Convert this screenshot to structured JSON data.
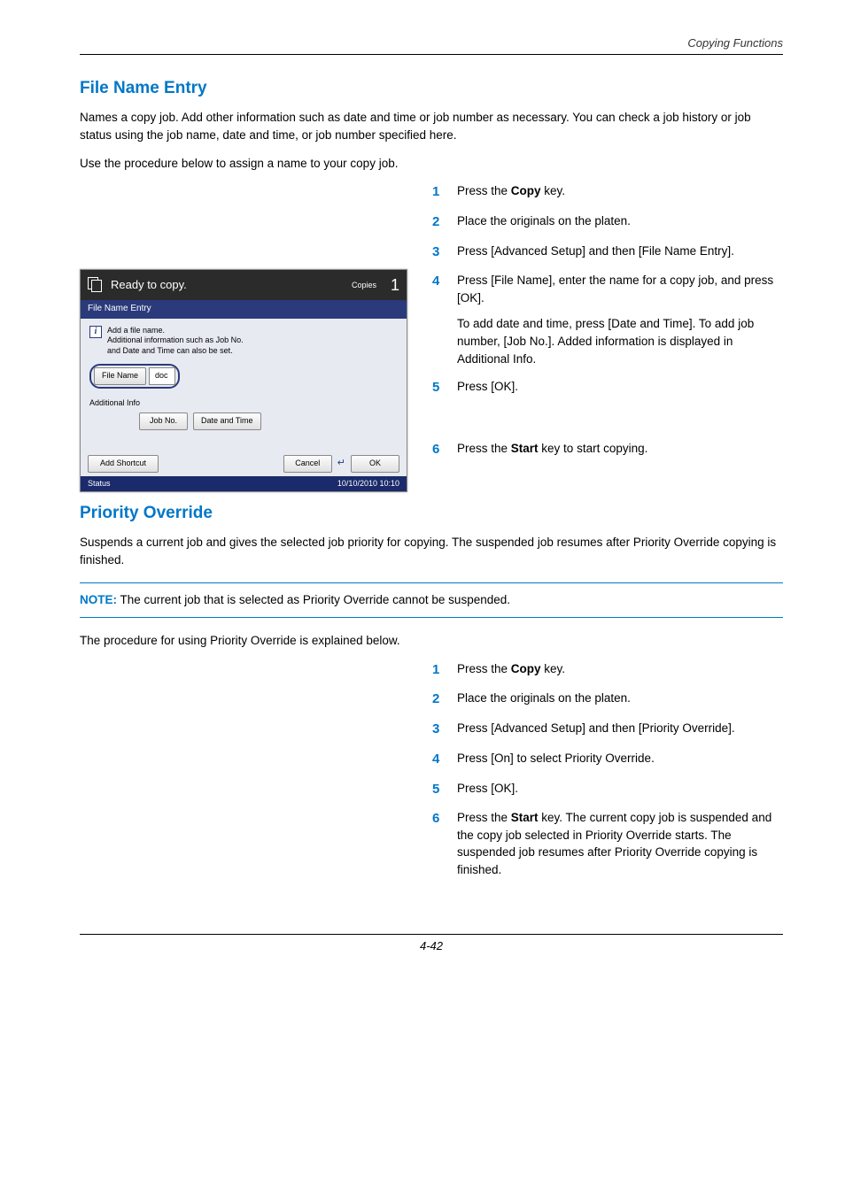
{
  "header": "Copying Functions",
  "fne": {
    "title": "File Name Entry",
    "intro1": "Names a copy job. Add other information such as date and time or job number as necessary. You can check a job history or job status using the job name, date and time, or job number specified here.",
    "intro2": "Use the procedure below to assign a name to your copy job.",
    "steps": {
      "s1": "Press the Copy key.",
      "s1_pre": "Press the ",
      "s1_b": "Copy",
      "s1_post": " key.",
      "s2": "Place the originals on the platen.",
      "s3": "Press [Advanced Setup] and then [File Name Entry].",
      "s4a": "Press [File Name], enter the name for a copy job, and press [OK].",
      "s4b": "To add date and time, press [Date and Time]. To add job number, [Job No.]. Added information is displayed in Additional Info.",
      "s5": "Press [OK].",
      "s6_pre": "Press the ",
      "s6_b": "Start",
      "s6_post": " key to start copying."
    }
  },
  "panel": {
    "ready": "Ready to copy.",
    "copies_label": "Copies",
    "copies_num": "1",
    "subhead": "File Name Entry",
    "info_line1": "Add a file name.",
    "info_line2": "Additional information such as Job No.",
    "info_line3": "and Date and Time can also be set.",
    "file_name_btn": "File Name",
    "doc_label": "doc",
    "addl_info": "Additional Info",
    "job_no_btn": "Job No.",
    "date_time_btn": "Date and Time",
    "add_shortcut": "Add Shortcut",
    "cancel": "Cancel",
    "ok": "OK",
    "status": "Status",
    "timestamp": "10/10/2010  10:10"
  },
  "po": {
    "title": "Priority Override",
    "intro": "Suspends a current job and gives the selected job priority for copying. The suspended job resumes after Priority Override copying is finished.",
    "note_label": "NOTE:",
    "note_text": " The current job that is selected as Priority Override cannot be suspended.",
    "intro2": "The procedure for using Priority Override is explained below.",
    "steps": {
      "s1_pre": "Press the ",
      "s1_b": "Copy",
      "s1_post": " key.",
      "s2": "Place the originals on the platen.",
      "s3": "Press [Advanced Setup] and then [Priority Override].",
      "s4": "Press [On] to select Priority Override.",
      "s5": "Press [OK].",
      "s6_pre": "Press the ",
      "s6_b": "Start",
      "s6_post": " key. The current copy job is suspended and the copy job selected in Priority Override starts. The suspended job resumes after Priority Override copying is finished."
    }
  },
  "footer": "4-42"
}
